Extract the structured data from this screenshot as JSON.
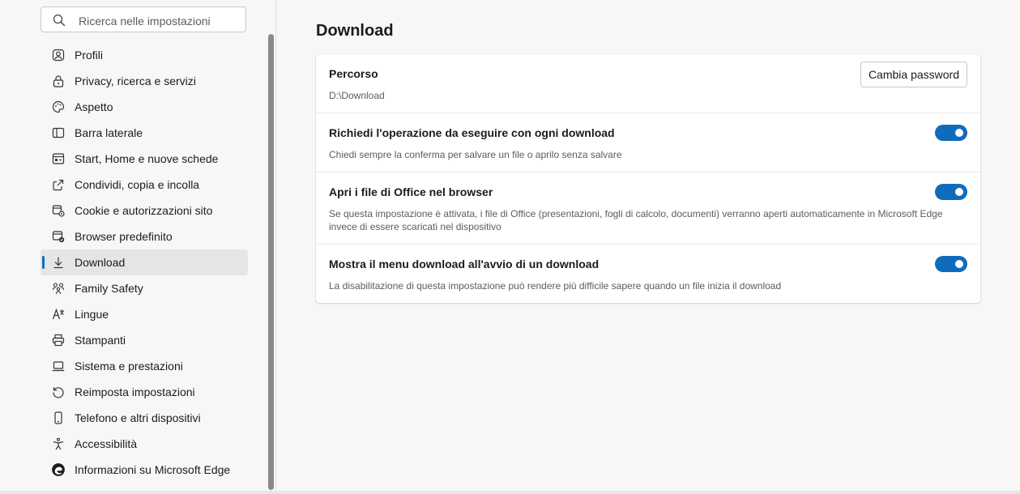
{
  "search": {
    "placeholder": "Ricerca nelle impostazioni"
  },
  "sidebar": {
    "items": [
      {
        "label": "Profili",
        "icon": "profile-icon"
      },
      {
        "label": "Privacy, ricerca e servizi",
        "icon": "lock-icon"
      },
      {
        "label": "Aspetto",
        "icon": "palette-icon"
      },
      {
        "label": "Barra laterale",
        "icon": "sidebar-icon"
      },
      {
        "label": "Start, Home e nuove schede",
        "icon": "home-tabs-icon"
      },
      {
        "label": "Condividi, copia e incolla",
        "icon": "share-icon"
      },
      {
        "label": "Cookie e autorizzazioni sito",
        "icon": "cookie-icon"
      },
      {
        "label": "Browser predefinito",
        "icon": "default-browser-icon"
      },
      {
        "label": "Download",
        "icon": "download-icon",
        "active": true
      },
      {
        "label": "Family Safety",
        "icon": "family-icon"
      },
      {
        "label": "Lingue",
        "icon": "language-icon"
      },
      {
        "label": "Stampanti",
        "icon": "printer-icon"
      },
      {
        "label": "Sistema e prestazioni",
        "icon": "laptop-icon"
      },
      {
        "label": "Reimposta impostazioni",
        "icon": "reset-icon"
      },
      {
        "label": "Telefono e altri dispositivi",
        "icon": "phone-icon"
      },
      {
        "label": "Accessibilità",
        "icon": "accessibility-icon"
      },
      {
        "label": "Informazioni su Microsoft Edge",
        "icon": "edge-logo-icon"
      }
    ]
  },
  "main": {
    "title": "Download",
    "location": {
      "title": "Percorso",
      "value": "D:\\Download",
      "button": "Cambia password"
    },
    "settings": [
      {
        "title": "Richiedi l'operazione da eseguire con ogni download",
        "desc": "Chiedi sempre la conferma per salvare un file o aprilo senza salvare",
        "enabled": true
      },
      {
        "title": "Apri i file di Office nel browser",
        "desc": "Se questa impostazione è attivata, i file di Office (presentazioni, fogli di calcolo, documenti) verranno aperti automaticamente in Microsoft Edge invece di essere scaricati nel dispositivo",
        "enabled": true
      },
      {
        "title": "Mostra il menu download all'avvio di un download",
        "desc": "La disabilitazione di questa impostazione può rendere più difficile sapere quando un file inizia il download",
        "enabled": true
      }
    ]
  },
  "colors": {
    "accent": "#0f6cbd",
    "active_bg": "#e5e5e5",
    "page_bg": "#f7f7f7"
  }
}
